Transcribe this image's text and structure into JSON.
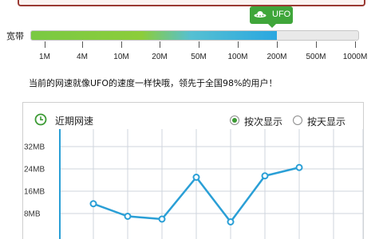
{
  "ufo_badge": {
    "label": "UFO",
    "icon": "ufo-icon"
  },
  "bandwidth": {
    "label": "宽带",
    "fill_fraction": 0.75,
    "ticks": [
      "1M",
      "4M",
      "10M",
      "20M",
      "50M",
      "100M",
      "200M",
      "500M",
      "1000M"
    ]
  },
  "notice": "当前的网速就像UFO的速度一样快哦，领先于全国98%的用户！",
  "panel": {
    "title": "近期网速",
    "icon": "clock-icon",
    "radio_per_test": {
      "label": "按次显示",
      "selected": true
    },
    "radio_per_day": {
      "label": "按天显示",
      "selected": false
    }
  },
  "chart_data": {
    "type": "line",
    "y_tick_labels": [
      "32MB",
      "24MB",
      "16MB",
      "8MB"
    ],
    "ylim": [
      0,
      36
    ],
    "grid": true,
    "color": "#2a9fd6",
    "series": [
      {
        "values": [
          11.5,
          7,
          6,
          21,
          5,
          21.5,
          24.5
        ]
      }
    ]
  }
}
